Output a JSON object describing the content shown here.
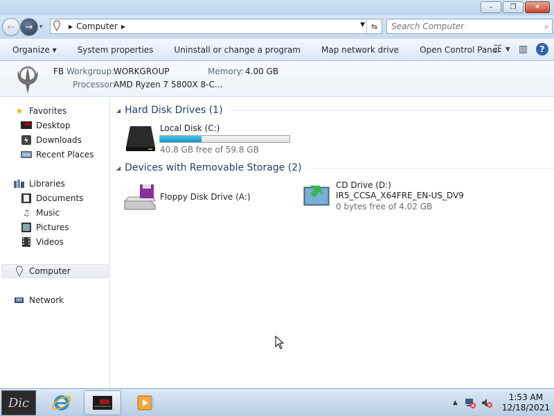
{
  "window": {
    "minimize": "–",
    "maximize": "❐",
    "close": "✕"
  },
  "address": {
    "crumb": "Computer",
    "arrow": "▶",
    "search_placeholder": "Search Computer"
  },
  "commands": {
    "organize": "Organize ▾",
    "system_properties": "System properties",
    "uninstall": "Uninstall or change a program",
    "map_drive": "Map network drive",
    "control_panel": "Open Control Panel",
    "help": "?"
  },
  "info": {
    "name": "FB",
    "workgroup_label": "Workgroup:",
    "workgroup_value": "WORKGROUP",
    "memory_label": "Memory:",
    "memory_value": "4.00 GB",
    "processor_label": "Processor:",
    "processor_value": "AMD Ryzen 7 5800X 8-C..."
  },
  "nav": {
    "favorites": "Favorites",
    "desktop": "Desktop",
    "downloads": "Downloads",
    "recent": "Recent Places",
    "libraries": "Libraries",
    "documents": "Documents",
    "music": "Music",
    "pictures": "Pictures",
    "videos": "Videos",
    "computer": "Computer",
    "network": "Network"
  },
  "groups": {
    "hdd": "Hard Disk Drives (1)",
    "removable": "Devices with Removable Storage (2)"
  },
  "drives": {
    "c": {
      "name": "Local Disk (C:)",
      "free": "40.8 GB free of 59.8 GB",
      "used_fraction": 0.32
    },
    "a": {
      "name": "Floppy Disk Drive (A:)"
    },
    "d": {
      "name": "CD Drive (D:)",
      "label": "IR5_CCSA_X64FRE_EN-US_DV9",
      "free": "0 bytes free of 4.02 GB"
    }
  },
  "taskbar": {
    "start": "Dic",
    "time": "1:53 AM",
    "date": "12/18/2021"
  }
}
